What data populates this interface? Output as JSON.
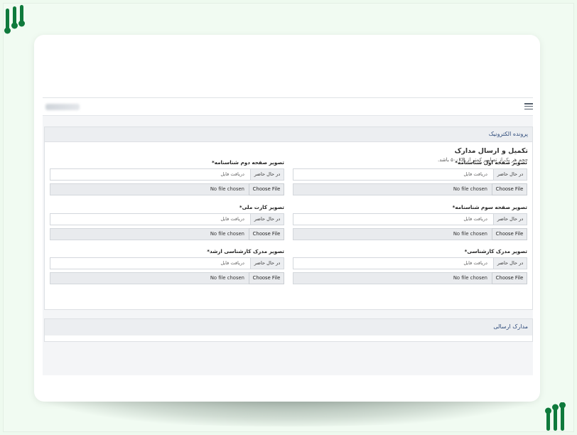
{
  "colors": {
    "background": "#eefaef",
    "brand_green": "#0f7a3c",
    "header_text": "#2d4a7a"
  },
  "logos": {
    "top_left": "brand-logo-icon",
    "bottom_right": "brand-logo-icon"
  },
  "topbar": {
    "menu_icon": "hamburger-menu-icon"
  },
  "panel": {
    "header": "پرونده الکترونیک",
    "title": "تکمیل و ارسال مدارک",
    "note": "حجم هر یک از تصاویر کمتر از ۵۰۰KB باشد.",
    "fields": [
      {
        "label": "تصویر صفحه اول شناسنامه*",
        "status": "در حال حاضر",
        "placeholder": "دریافت فایل",
        "button": "Choose File",
        "file_status": "No file chosen"
      },
      {
        "label": "تصویر صفحه دوم شناسنامه*",
        "status": "در حال حاضر",
        "placeholder": "دریافت فایل",
        "button": "Choose File",
        "file_status": "No file chosen"
      },
      {
        "label": "تصویر صفحه سوم شناسنامه*",
        "status": "در حال حاضر",
        "placeholder": "دریافت فایل",
        "button": "Choose File",
        "file_status": "No file chosen"
      },
      {
        "label": "تصویر کارت ملی*",
        "status": "در حال حاضر",
        "placeholder": "دریافت فایل",
        "button": "Choose File",
        "file_status": "No file chosen"
      },
      {
        "label": "تصویر مدرک کارشناسی*",
        "status": "در حال حاضر",
        "placeholder": "دریافت فایل",
        "button": "Choose File",
        "file_status": "No file chosen"
      },
      {
        "label": "تصویر مدرک کارشناسی ارشد*",
        "status": "در حال حاضر",
        "placeholder": "دریافت فایل",
        "button": "Choose File",
        "file_status": "No file chosen"
      }
    ]
  },
  "panel2": {
    "header": "مدارک ارسالی"
  }
}
